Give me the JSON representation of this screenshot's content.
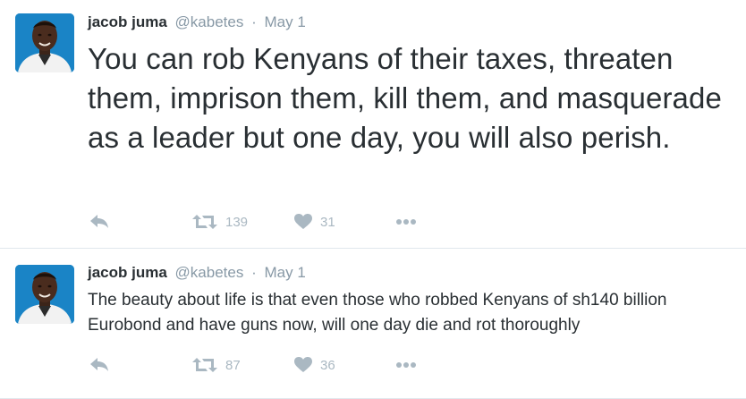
{
  "tweets": [
    {
      "author_name": "jacob juma",
      "handle": "@kabetes",
      "separator": "·",
      "date": "May 1",
      "text": "You can rob Kenyans of their taxes, threaten them, imprison them, kill them, and masquerade as a leader but one day, you will also perish.",
      "retweet_count": "139",
      "like_count": "31",
      "icons": [
        "reply-icon",
        "retweet-icon",
        "heart-icon",
        "more-icon"
      ]
    },
    {
      "author_name": "jacob juma",
      "handle": "@kabetes",
      "separator": "·",
      "date": "May 1",
      "text": "The beauty about life is that even those who robbed Kenyans of sh140 billion Eurobond and have guns now, will one day die and rot thoroughly",
      "retweet_count": "87",
      "like_count": "36",
      "icons": [
        "reply-icon",
        "retweet-icon",
        "heart-icon",
        "more-icon"
      ]
    }
  ],
  "colors": {
    "text": "#292f33",
    "muted": "#8899a6",
    "icon": "#aab8c2",
    "divider": "#e1e8ed",
    "avatar_background": "#1a84c6"
  }
}
